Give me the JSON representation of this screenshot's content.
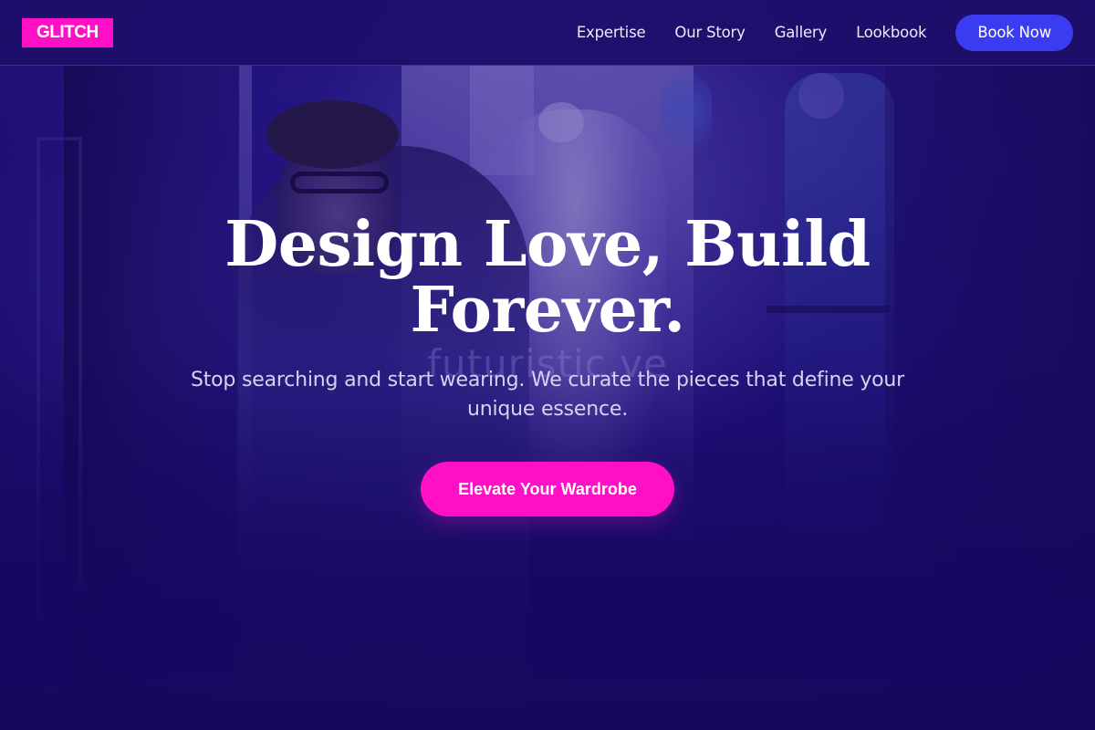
{
  "brand": {
    "logo_text": "GLITCH",
    "logo_color": "#ff0fc6"
  },
  "nav": {
    "links": [
      {
        "label": "Expertise"
      },
      {
        "label": "Our Story"
      },
      {
        "label": "Gallery"
      },
      {
        "label": "Lookbook"
      }
    ],
    "cta_label": "Book Now",
    "cta_color": "#3b3bf2"
  },
  "hero": {
    "headline": "Design Love, Build Forever.",
    "background_overlay_text": "futuristic.ve",
    "subtitle": "Stop searching and start wearing. We curate the pieces that define your unique essence.",
    "cta_label": "Elevate Your Wardrobe",
    "cta_color": "#ff0fc6",
    "background_image": "menswear-boutique-photo"
  },
  "theme": {
    "background": "#1a0a66",
    "text": "#ffffff"
  }
}
